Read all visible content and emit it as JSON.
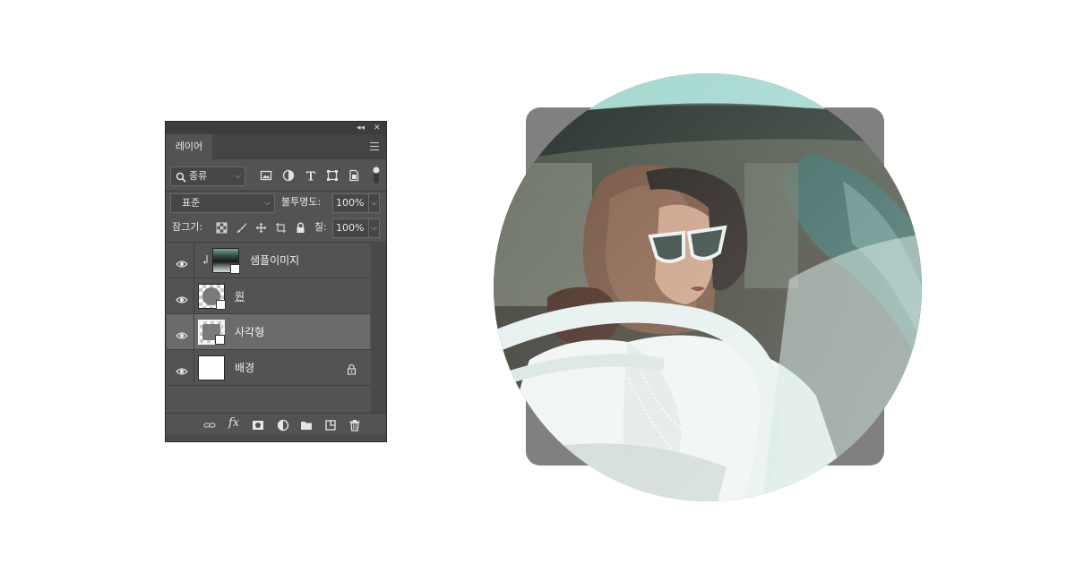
{
  "panel": {
    "tab_label": "레이어",
    "collapse_glyph": "◂◂",
    "close_glyph": "✕",
    "filter": {
      "kind_label": "종류",
      "icons": [
        "image-filter-icon",
        "adjustment-filter-icon",
        "type-filter-icon",
        "shape-filter-icon",
        "smart-object-filter-icon"
      ]
    },
    "blend": {
      "mode": "표준",
      "opacity_label": "불투명도:",
      "opacity_value": "100%"
    },
    "lock": {
      "label": "잠그기:",
      "fill_label": "칠:",
      "fill_value": "100%"
    },
    "layers": [
      {
        "name": "샘플이미지",
        "clipped": true,
        "visible": true,
        "selected": false,
        "type": "image"
      },
      {
        "name": "원",
        "clipped": false,
        "visible": true,
        "selected": false,
        "type": "shape"
      },
      {
        "name": "사각형",
        "clipped": false,
        "visible": true,
        "selected": true,
        "type": "shape"
      },
      {
        "name": "배경",
        "clipped": false,
        "visible": true,
        "selected": false,
        "type": "background",
        "locked": true
      }
    ],
    "bottom_icons": [
      "link-layers-icon",
      "fx-icon",
      "add-mask-icon",
      "adjustment-layer-icon",
      "new-group-icon",
      "new-layer-icon",
      "trash-icon"
    ],
    "fx_label": "fx"
  },
  "colors": {
    "panel_bg": "#535353",
    "selected_row": "#6b6b6b",
    "rect_fill": "#808080",
    "teal_accent": "#9ed6cd"
  }
}
